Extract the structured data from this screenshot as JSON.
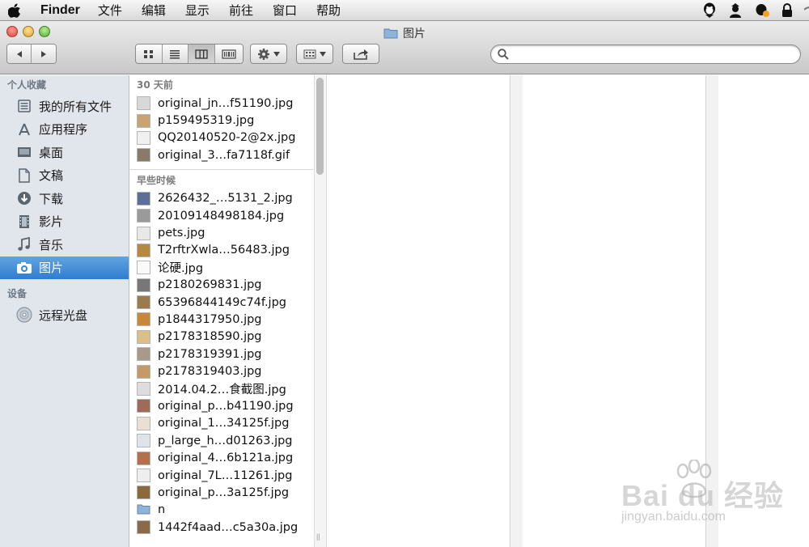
{
  "menubar": {
    "app": "Finder",
    "items": [
      "文件",
      "编辑",
      "显示",
      "前往",
      "窗口",
      "帮助"
    ]
  },
  "window": {
    "title": "图片"
  },
  "search": {
    "placeholder": "",
    "value": ""
  },
  "sidebar": {
    "favorites_header": "个人收藏",
    "favorites": [
      {
        "label": "我的所有文件",
        "icon": "all-files-icon"
      },
      {
        "label": "应用程序",
        "icon": "applications-icon"
      },
      {
        "label": "桌面",
        "icon": "desktop-icon"
      },
      {
        "label": "文稿",
        "icon": "documents-icon"
      },
      {
        "label": "下载",
        "icon": "downloads-icon"
      },
      {
        "label": "影片",
        "icon": "movies-icon"
      },
      {
        "label": "音乐",
        "icon": "music-icon"
      },
      {
        "label": "图片",
        "icon": "pictures-icon",
        "selected": true
      }
    ],
    "devices_header": "设备",
    "devices": [
      {
        "label": "远程光盘",
        "icon": "remote-disc-icon"
      }
    ]
  },
  "column1": {
    "group1_header": "30 天前",
    "group1": [
      "original_jn…f51190.jpg",
      "p159495319.jpg",
      "QQ20140520-2@2x.jpg",
      "original_3…fa7118f.gif"
    ],
    "group2_header": "早些时候",
    "group2": [
      "2626432_…5131_2.jpg",
      "20109148498184.jpg",
      "pets.jpg",
      "T2rftrXwla…56483.jpg",
      "论硬.jpg",
      "p2180269831.jpg",
      "65396844149c74f.jpg",
      "p1844317950.jpg",
      "p2178318590.jpg",
      "p2178319391.jpg",
      "p2178319403.jpg",
      "2014.04.2…食截图.jpg",
      "original_p…b41190.jpg",
      "original_1…34125f.jpg",
      "p_large_h…d01263.jpg",
      "original_4…6b121a.jpg",
      "original_7L…11261.jpg",
      "original_p…3a125f.jpg",
      "n",
      "1442f4aad…c5a30a.jpg"
    ]
  },
  "watermark": {
    "brand": "Bai du 经验",
    "url": "jingyan.baidu.com"
  }
}
